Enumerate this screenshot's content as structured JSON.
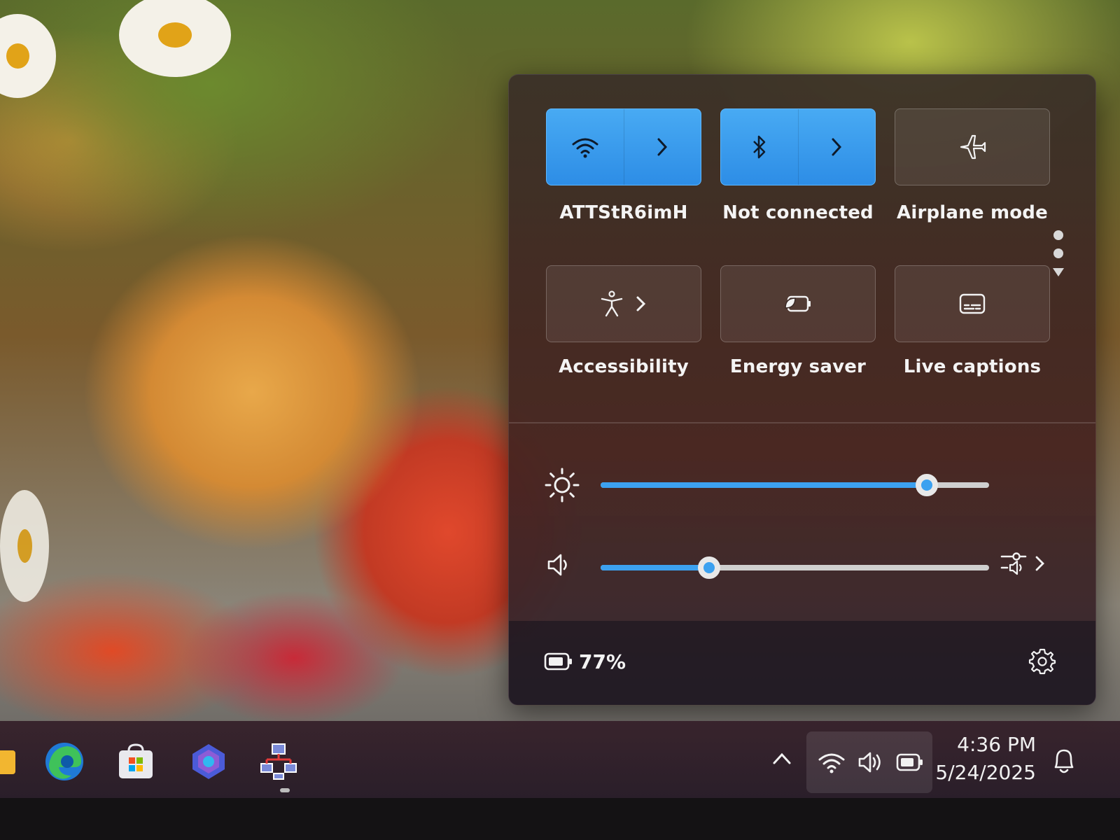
{
  "quick_settings": {
    "tiles": [
      {
        "label": "ATTStR6imH",
        "icon": "wifi-icon",
        "state": "on",
        "has_chevron": true
      },
      {
        "label": "Not connected",
        "icon": "bluetooth-icon",
        "state": "on",
        "has_chevron": true
      },
      {
        "label": "Airplane mode",
        "icon": "airplane-icon",
        "state": "off",
        "has_chevron": false
      },
      {
        "label": "Accessibility",
        "icon": "accessibility-icon",
        "state": "off",
        "has_chevron": true
      },
      {
        "label": "Energy saver",
        "icon": "energy-saver-icon",
        "state": "off",
        "has_chevron": false
      },
      {
        "label": "Live captions",
        "icon": "live-captions-icon",
        "state": "off",
        "has_chevron": false
      }
    ],
    "brightness": {
      "icon": "brightness-icon",
      "level_fraction": 0.84
    },
    "volume": {
      "icon": "speaker-icon",
      "level_fraction": 0.28,
      "mixer_icon": "audio-mixer-icon"
    },
    "battery": {
      "icon": "battery-icon",
      "percent_text": "77%"
    },
    "settings_icon": "gear-icon"
  },
  "taskbar": {
    "pinned": [
      "file-explorer-icon",
      "edge-icon",
      "store-icon",
      "copilot-icon",
      "network-app-icon"
    ],
    "tray": {
      "overflow_icon": "chevron-up-icon",
      "wifi_icon": "wifi-icon",
      "volume_icon": "speaker-icon",
      "battery_icon": "battery-icon"
    },
    "clock": {
      "time": "4:36 PM",
      "date": "5/24/2025"
    },
    "notification_icon": "bell-icon"
  },
  "colors": {
    "accent": "#3ca1f0",
    "tile_on": "#3d9ff0"
  }
}
